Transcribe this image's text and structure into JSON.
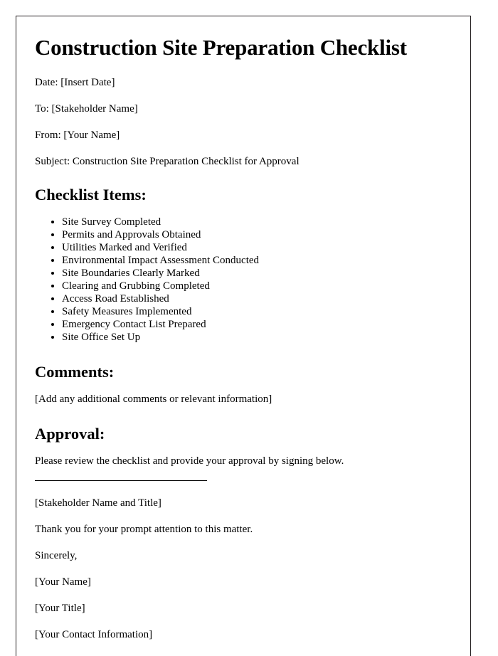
{
  "document": {
    "title": "Construction Site Preparation Checklist",
    "meta": [
      "Date: [Insert Date]",
      "To: [Stakeholder Name]",
      "From: [Your Name]",
      "Subject: Construction Site Preparation Checklist for Approval"
    ],
    "checklist_section": {
      "heading": "Checklist Items:",
      "items": [
        "Site Survey Completed",
        "Permits and Approvals Obtained",
        "Utilities Marked and Verified",
        "Environmental Impact Assessment Conducted",
        "Site Boundaries Clearly Marked",
        "Clearing and Grubbing Completed",
        "Access Road Established",
        "Safety Measures Implemented",
        "Emergency Contact List Prepared",
        "Site Office Set Up"
      ]
    },
    "comments_section": {
      "heading": "Comments:",
      "placeholder_text": "[Add any additional comments or relevant information]"
    },
    "approval_section": {
      "heading": "Approval:",
      "intro": "Please review the checklist and provide your approval by signing below.",
      "signature_caption": "[Stakeholder Name and Title]"
    },
    "closing": [
      "Thank you for your prompt attention to this matter.",
      "Sincerely,",
      "[Your Name]",
      "[Your Title]",
      "[Your Contact Information]"
    ]
  },
  "colors": {
    "text": "#000000",
    "page_background": "#ffffff",
    "page_border": "#231f20"
  }
}
